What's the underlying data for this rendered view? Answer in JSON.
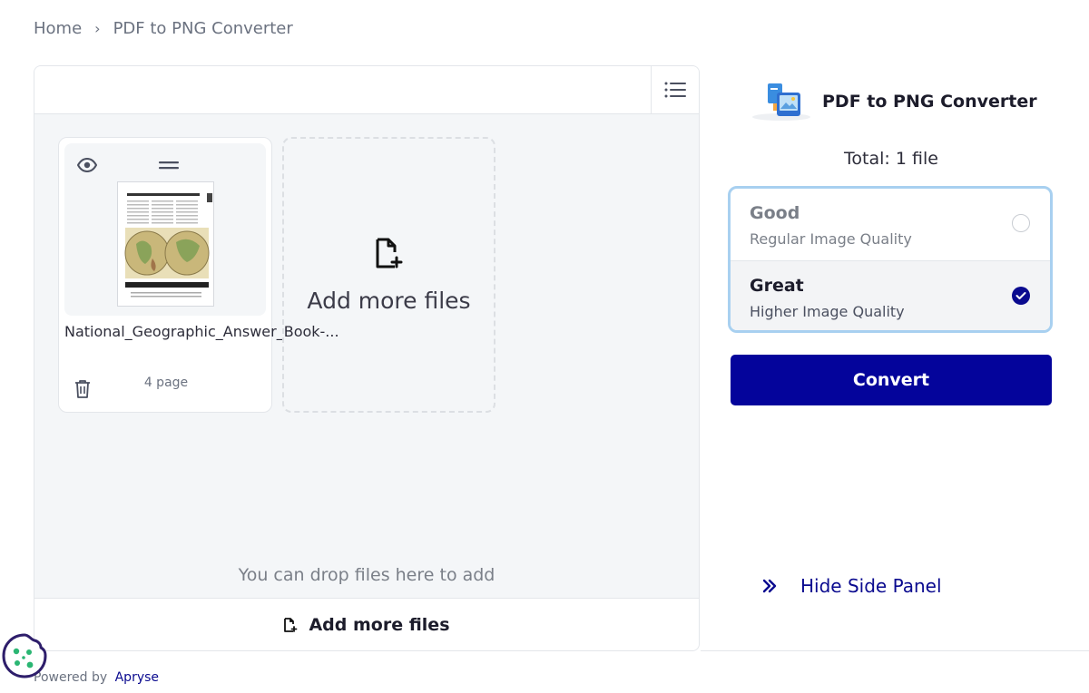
{
  "breadcrumb": {
    "home": "Home",
    "separator": "›",
    "current": "PDF to PNG Converter"
  },
  "file_panel": {
    "files": [
      {
        "name": "National_Geographic_Answer_Book-...",
        "pages": "4 page"
      }
    ],
    "add_card_label": "Add more files",
    "drop_hint": "You can drop files here to add",
    "bottom_add_label": "Add more files"
  },
  "side_panel": {
    "title": "PDF to PNG Converter",
    "total": "Total: 1 file",
    "quality_options": [
      {
        "name": "Good",
        "description": "Regular Image Quality",
        "selected": false
      },
      {
        "name": "Great",
        "description": "Higher Image Quality",
        "selected": true
      }
    ],
    "convert_label": "Convert",
    "hide_panel_label": "Hide Side Panel"
  },
  "footer": {
    "powered_by": "Powered by",
    "brand": "Apryse"
  },
  "colors": {
    "accent": "#04049b",
    "selected_radio": "#0a0a8f",
    "quality_border": "#a8d0f0",
    "cookie": "#2e1e6b"
  }
}
